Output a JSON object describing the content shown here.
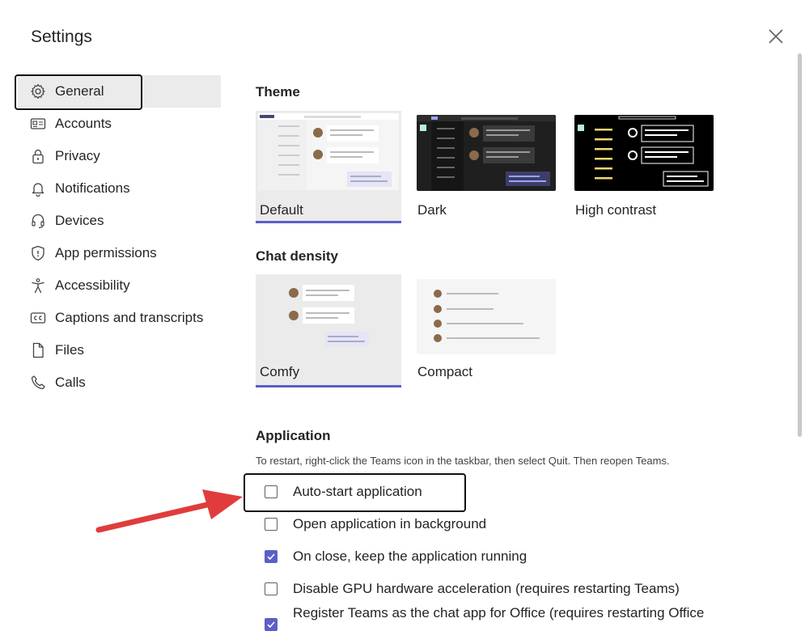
{
  "header": {
    "title": "Settings",
    "close_icon": "close-icon"
  },
  "nav": {
    "items": [
      {
        "label": "General",
        "icon": "gear-icon",
        "active": true
      },
      {
        "label": "Accounts",
        "icon": "id-card-icon"
      },
      {
        "label": "Privacy",
        "icon": "lock-icon"
      },
      {
        "label": "Notifications",
        "icon": "bell-icon"
      },
      {
        "label": "Devices",
        "icon": "headset-icon"
      },
      {
        "label": "App permissions",
        "icon": "shield-icon"
      },
      {
        "label": "Accessibility",
        "icon": "accessibility-icon"
      },
      {
        "label": "Captions and transcripts",
        "icon": "cc-icon"
      },
      {
        "label": "Files",
        "icon": "file-icon"
      },
      {
        "label": "Calls",
        "icon": "phone-icon"
      }
    ]
  },
  "theme": {
    "title": "Theme",
    "options": [
      {
        "label": "Default",
        "selected": true
      },
      {
        "label": "Dark",
        "selected": false
      },
      {
        "label": "High contrast",
        "selected": false
      }
    ]
  },
  "density": {
    "title": "Chat density",
    "options": [
      {
        "label": "Comfy",
        "selected": true
      },
      {
        "label": "Compact",
        "selected": false
      }
    ]
  },
  "application": {
    "title": "Application",
    "description": "To restart, right-click the Teams icon in the taskbar, then select Quit. Then reopen Teams.",
    "options": [
      {
        "label": "Auto-start application",
        "checked": false
      },
      {
        "label": "Open application in background",
        "checked": false
      },
      {
        "label": "On close, keep the application running",
        "checked": true
      },
      {
        "label": "Disable GPU hardware acceleration (requires restarting Teams)",
        "checked": false
      },
      {
        "label": "Register Teams as the chat app for Office (requires restarting Office",
        "checked": true
      }
    ]
  },
  "colors": {
    "accent": "#5b5fc7",
    "annotation_arrow": "#e03c3c",
    "highlight_border": "#111111"
  }
}
